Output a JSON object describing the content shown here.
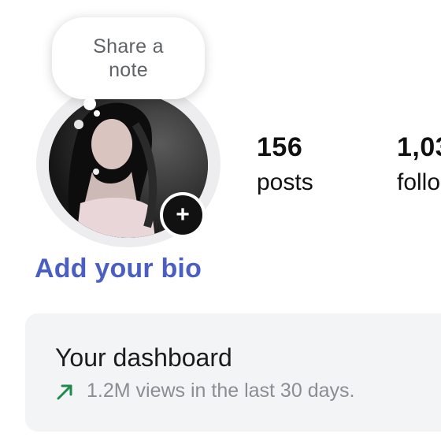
{
  "profile": {
    "note_prompt": "Share a\nnote",
    "add_bio": "Add your bio"
  },
  "stats": {
    "posts_value": "156",
    "posts_label": "posts",
    "followers_value": "1,03",
    "followers_label": "follo"
  },
  "dashboard": {
    "title": "Your dashboard",
    "summary": "1.2M views in the last 30 days."
  },
  "icons": {
    "add_story": "plus-icon",
    "trend": "trending-up-arrow-icon"
  },
  "colors": {
    "bio_link": "#4a5fc1",
    "trend_arrow": "#1f8a4c",
    "card_bg": "#f3f4f6"
  }
}
